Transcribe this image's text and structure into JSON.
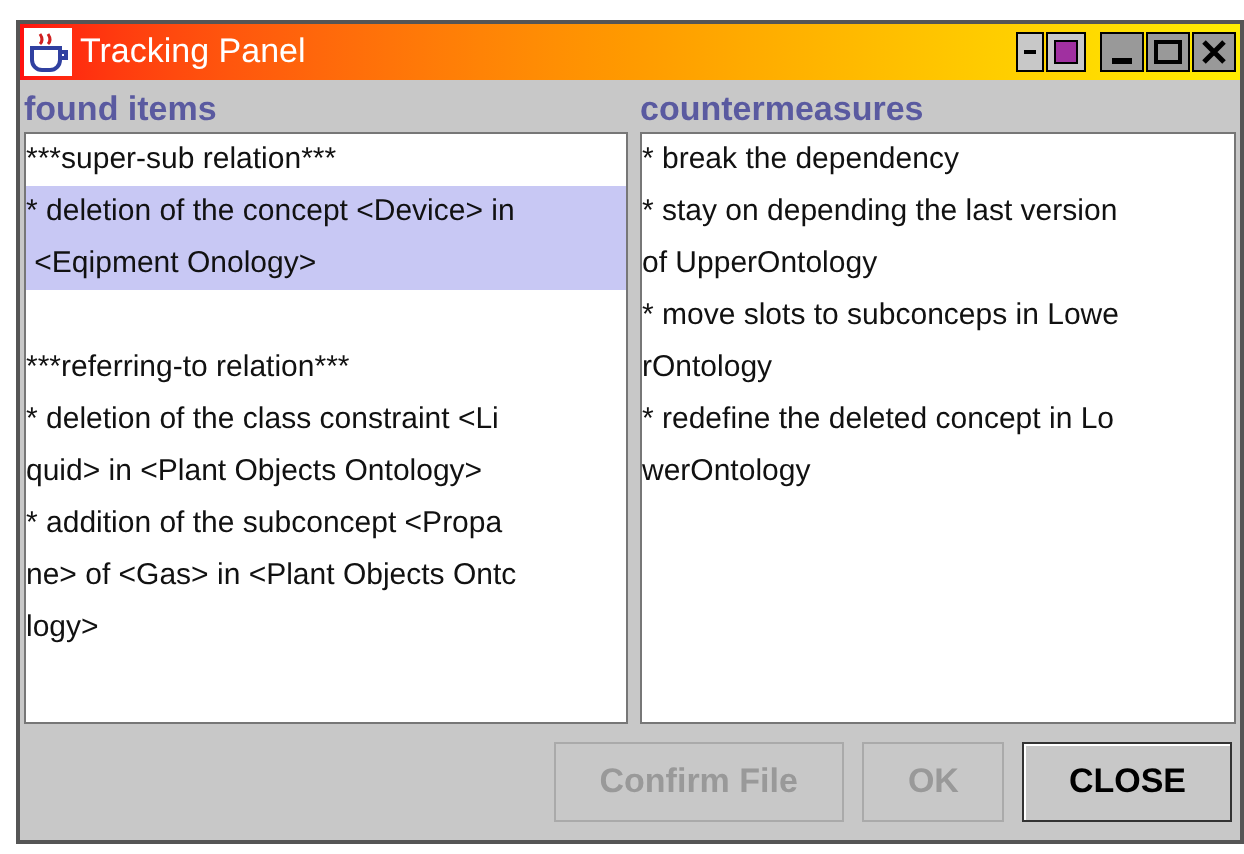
{
  "window": {
    "title": "Tracking Panel"
  },
  "found_items": {
    "label": "found items",
    "entries": [
      {
        "kind": "header",
        "lines": [
          "***super-sub relation***"
        ],
        "selected": false
      },
      {
        "kind": "item",
        "lines": [
          "* deletion of the concept <Device> in",
          " <Eqipment Onology>"
        ],
        "selected": true
      },
      {
        "kind": "header",
        "lines": [
          "***referring-to relation***"
        ],
        "selected": false
      },
      {
        "kind": "item",
        "lines": [
          "* deletion of the class constraint <Li",
          "quid> in <Plant Objects Ontology>"
        ],
        "selected": false
      },
      {
        "kind": "item",
        "lines": [
          "* addition of the subconcept <Propa",
          "ne> of <Gas> in <Plant Objects Ontc",
          "logy>"
        ],
        "selected": false
      }
    ]
  },
  "countermeasures": {
    "label": "countermeasures",
    "entries": [
      {
        "lines": [
          "* break the dependency"
        ]
      },
      {
        "lines": [
          "* stay on depending the last version",
          "of UpperOntology"
        ]
      },
      {
        "lines": [
          "* move slots to subconceps in Lowe",
          "rOntology"
        ]
      },
      {
        "lines": [
          "* redefine the deleted concept in Lo",
          "werOntology"
        ]
      }
    ]
  },
  "buttons": [
    {
      "label": "Confirm File",
      "disabled": true
    },
    {
      "label": "OK",
      "disabled": true
    },
    {
      "label": "CLOSE",
      "disabled": false
    }
  ]
}
